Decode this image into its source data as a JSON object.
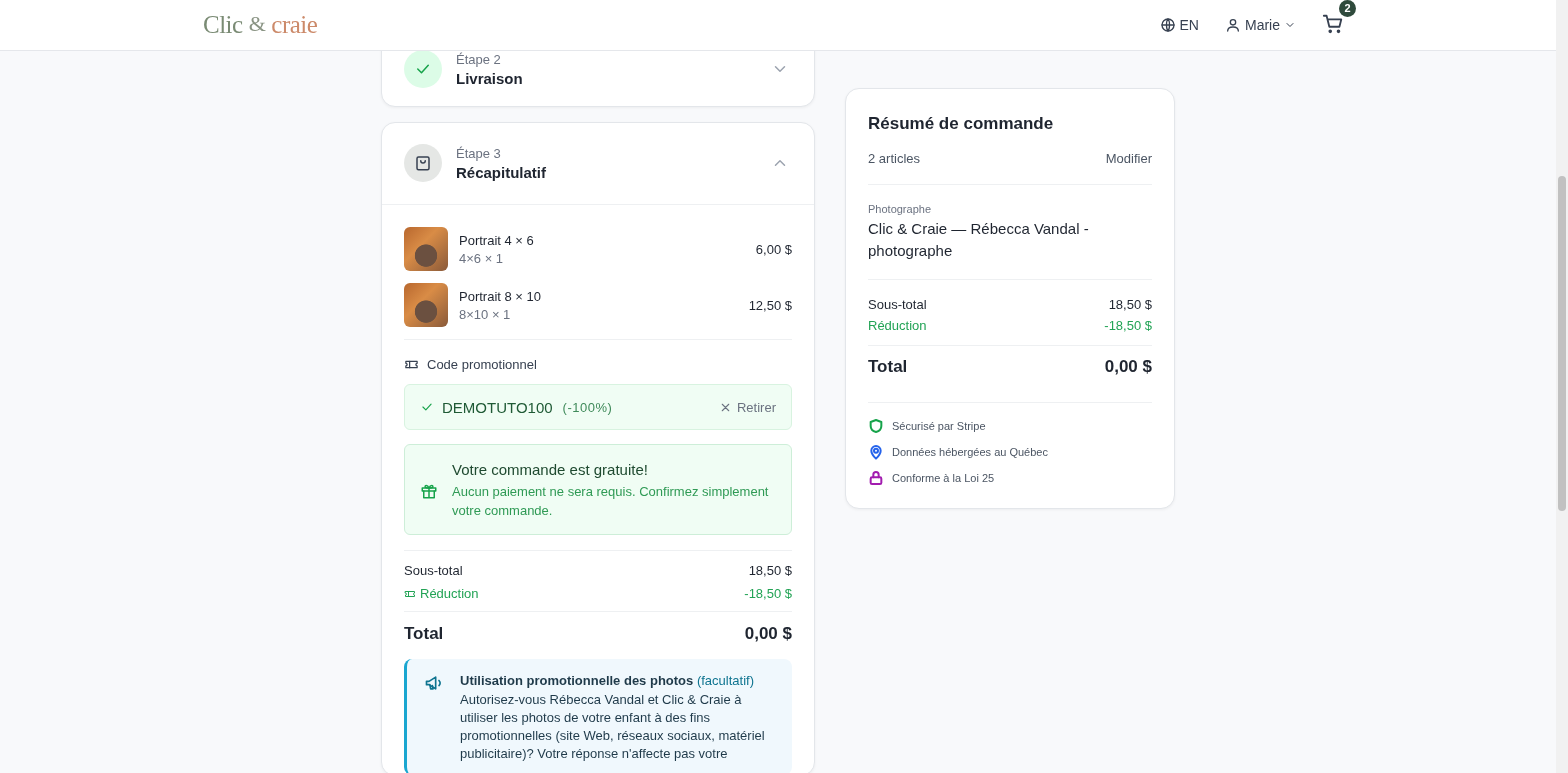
{
  "header": {
    "logo": [
      "Clic",
      "&",
      "craie"
    ],
    "language": "EN",
    "user": "Marie",
    "cart_count": "2"
  },
  "steps": [
    {
      "kind": "done",
      "label": "Étape 2",
      "title": "Livraison",
      "expanded": false
    },
    {
      "kind": "current",
      "label": "Étape 3",
      "title": "Récapitulatif",
      "expanded": true
    }
  ],
  "items": [
    {
      "name": "Portrait 4 × 6",
      "variant": "4×6 × 1",
      "price": "6,00 $"
    },
    {
      "name": "Portrait 8 × 10",
      "variant": "8×10 × 1",
      "price": "12,50 $"
    }
  ],
  "promo": {
    "label": "Code promotionnel",
    "code": "DEMOTUTO100",
    "discount": "(-100%)",
    "remove": "Retirer"
  },
  "free_notice": {
    "title": "Votre commande est gratuite!",
    "text": "Aucun paiement ne sera requis. Confirmez simplement votre commande."
  },
  "totals": [
    {
      "kind": "normal",
      "label": "Sous-total",
      "value": "18,50 $"
    },
    {
      "kind": "discount",
      "label": "Réduction",
      "value": "-18,50 $"
    },
    {
      "kind": "total",
      "label": "Total",
      "value": "0,00 $"
    }
  ],
  "consent": {
    "title": "Utilisation promotionnelle des photos",
    "optional": "(facultatif)",
    "text": "Autorisez-vous Rébecca Vandal et Clic & Craie à utiliser les photos de votre enfant à des fins promotionnelles (site Web, réseaux sociaux, matériel publicitaire)? Votre réponse n'affecte pas votre"
  },
  "summary": {
    "title": "Résumé de commande",
    "count": "2 articles",
    "edit": "Modifier",
    "photographer_label": "Photographe",
    "photographer": "Clic & Craie — Rébecca Vandal - photographe",
    "totals": [
      {
        "kind": "normal",
        "label": "Sous-total",
        "value": "18,50 $"
      },
      {
        "kind": "discount",
        "label": "Réduction",
        "value": "-18,50 $"
      },
      {
        "kind": "total",
        "label": "Total",
        "value": "0,00 $"
      }
    ],
    "badges": [
      {
        "kind": "shield",
        "text": "Sécurisé par Stripe",
        "color": "#16a34a"
      },
      {
        "kind": "pin",
        "text": "Données hébergées au Québec",
        "color": "#2563eb"
      },
      {
        "kind": "lock",
        "text": "Conforme à la Loi 25",
        "color": "#a21caf"
      }
    ]
  }
}
